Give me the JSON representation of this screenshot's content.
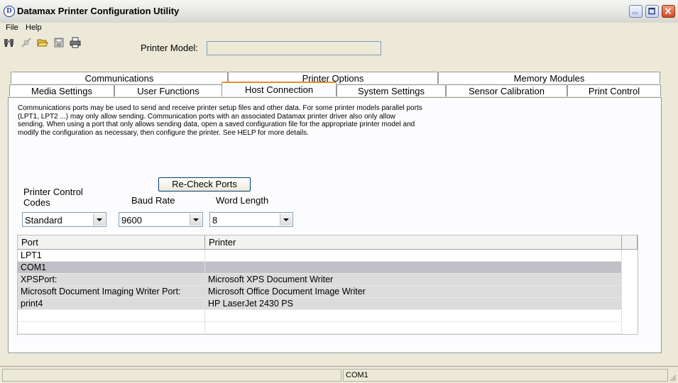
{
  "window": {
    "title": "Datamax Printer Configuration Utility",
    "icon_letter": "D"
  },
  "menu": {
    "file": "File",
    "help": "Help"
  },
  "toolbar": {
    "icons": [
      "search-printer-icon",
      "disconnect-icon",
      "open-folder-icon",
      "save-disk-icon",
      "printer-icon"
    ]
  },
  "printer_model": {
    "label": "Printer Model:",
    "value": ""
  },
  "tabs": {
    "row1": [
      "Communications",
      "Printer Options",
      "Memory Modules"
    ],
    "row2": [
      "Media Settings",
      "User Functions",
      "Host Connection",
      "System Settings",
      "Sensor Calibration",
      "Print Control"
    ],
    "active": "Host Connection"
  },
  "host": {
    "description": "Communications ports may be used to send and receive printer setup files and other data. For some printer models parallel ports (LPT1, LPT2 ...) may only allow sending. Communication ports with an associated Datamax printer driver also only allow sending. When using a port that only allows sending data, open a saved configuration file for the appropriate printer model and modify the configuration as necessary, then configure the printer.  See HELP for more details.",
    "recheck_label": "Re-Check Ports",
    "control_codes_label": "Printer Control Codes",
    "control_codes_value": "Standard",
    "baud_label": "Baud Rate",
    "baud_value": "9600",
    "word_label": "Word Length",
    "word_value": "8"
  },
  "ports_table": {
    "columns": [
      "Port",
      "Printer"
    ],
    "rows": [
      {
        "port": "LPT1",
        "printer": ""
      },
      {
        "port": "COM1",
        "printer": ""
      },
      {
        "port": "XPSPort:",
        "printer": "Microsoft XPS Document Writer"
      },
      {
        "port": "Microsoft Document Imaging Writer Port:",
        "printer": "Microsoft Office Document Image Writer"
      },
      {
        "port": "print4",
        "printer": "HP LaserJet 2430 PS"
      }
    ],
    "selected_index": 1
  },
  "status": {
    "pane1": "",
    "pane2": "COM1"
  }
}
